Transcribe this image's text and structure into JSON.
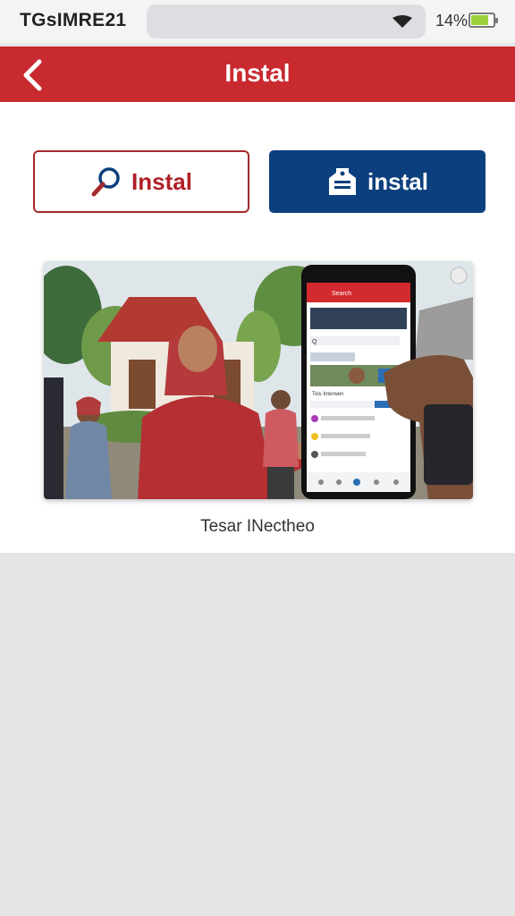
{
  "status_bar": {
    "time": "TGsIMRE21",
    "battery_percent": "14%",
    "battery_level": 0.8,
    "icons": [
      "wifi-icon",
      "battery-icon"
    ]
  },
  "header": {
    "title": "Instal",
    "back_icon": "chevron-left-icon",
    "background_color": "#c92a2f"
  },
  "buttons": {
    "search_install": {
      "label": "Instal",
      "icon": "search-icon",
      "color": "#b02027"
    },
    "app_install": {
      "label": "instal",
      "icon": "install-tag-icon",
      "color": "#0c3f7d"
    }
  },
  "image": {
    "caption": "Tesar INectheo",
    "phone_screen": {
      "header_label": "Search",
      "search_label": "Q",
      "section_label": "Tois Interwen"
    }
  }
}
